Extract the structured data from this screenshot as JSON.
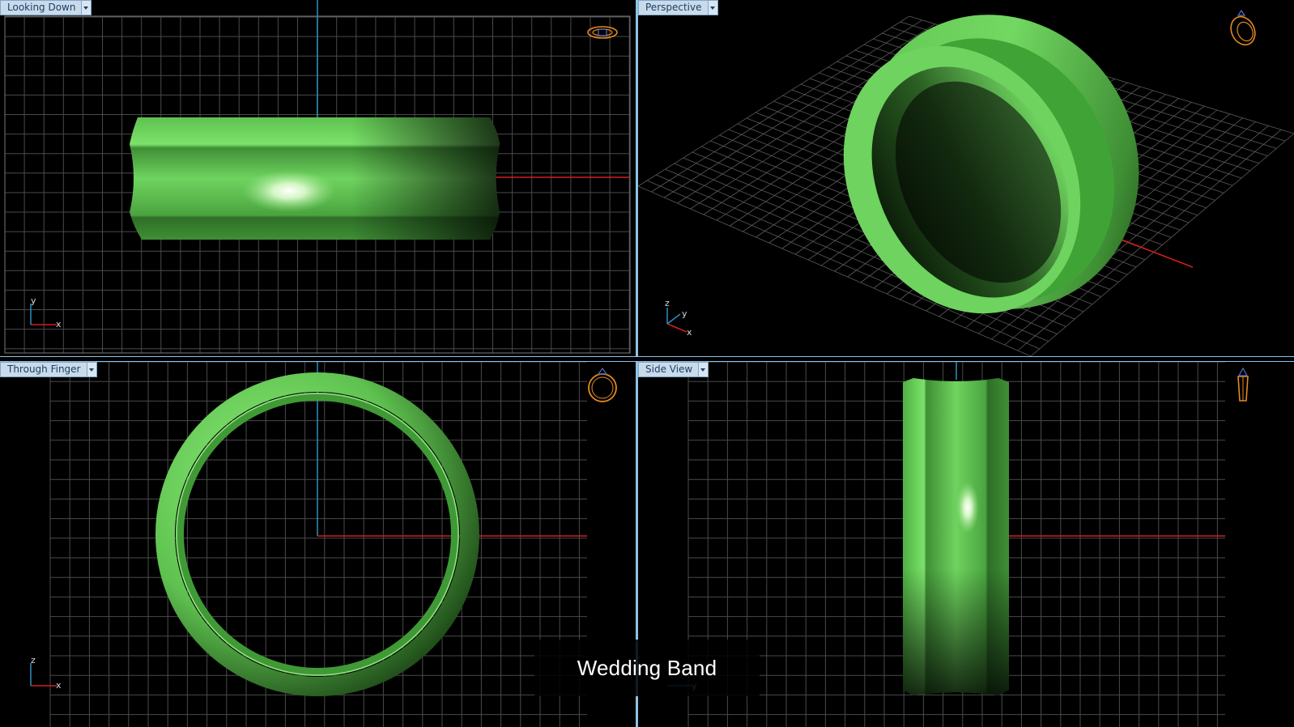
{
  "viewports": {
    "top_left": {
      "label": "Looking Down",
      "axes": {
        "vertical": "y",
        "horizontal": "x"
      },
      "nav_icon": "ring-top-view-icon"
    },
    "top_right": {
      "label": "Perspective",
      "axes": {
        "vertical": "z",
        "secondary": "y",
        "horizontal": "x"
      },
      "nav_icon": "ring-perspective-icon"
    },
    "bottom_left": {
      "label": "Through Finger",
      "axes": {
        "vertical": "z",
        "horizontal": "x"
      },
      "nav_icon": "ring-front-icon"
    },
    "bottom_right": {
      "label": "Side View",
      "axes": {
        "horizontal": "y"
      },
      "nav_icon": "ring-side-icon"
    }
  },
  "caption": "Wedding Band",
  "colors": {
    "background": "#000000",
    "grid": "#4a4a4a",
    "axis_x": "#d21f1f",
    "axis_y": "#2a90c0",
    "ring": "#6fd35f",
    "tab": "#c9dbea",
    "divider": "#8fc1e6"
  }
}
